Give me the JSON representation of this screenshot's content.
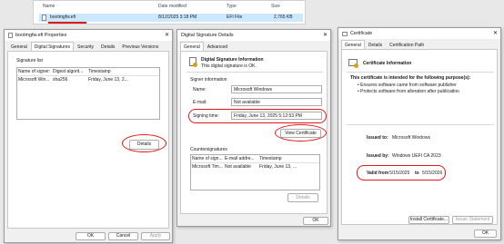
{
  "explorer": {
    "columns": {
      "name": "Name",
      "date": "Date modified",
      "type": "Type",
      "size": "Size"
    },
    "row": {
      "name": "bootmgfw.efi",
      "date": "8/12/2025 3:18 PM",
      "type": "EFI File",
      "size": "2,765 KB"
    }
  },
  "props": {
    "title": "bootmgfw.efi Properties",
    "tabs": [
      "General",
      "Digital Signatures",
      "Security",
      "Details",
      "Previous Versions"
    ],
    "sig_list_label": "Signature list",
    "columns": [
      "Name of signer:",
      "Digest algorit...",
      "Timestamp"
    ],
    "rows": [
      [
        "Microsoft Win...",
        "sha256",
        "Friday, June 13, 2..."
      ]
    ],
    "details_button": "Details",
    "ok": "OK",
    "cancel": "Cancel",
    "apply": "Apply"
  },
  "dsd": {
    "title": "Digital Signature Details",
    "tabs": [
      "General",
      "Advanced"
    ],
    "info_title": "Digital Signature Information",
    "info_sub": "This digital signature is OK.",
    "signer_label": "Signer information",
    "name_label": "Name:",
    "name_value": "Microsoft Windows",
    "email_label": "E-mail:",
    "email_value": "Not available",
    "signing_label": "Signing time:",
    "signing_value": "Friday, June 13, 2025 5:12:53 PM",
    "view_cert": "View Certificate",
    "countersig_label": "Countersignatures",
    "cs_columns": [
      "Name of sign...",
      "E-mail addre...",
      "Timestamp"
    ],
    "cs_rows": [
      [
        "Microsoft Tim...",
        "Not available",
        "Friday, June 13, ..."
      ]
    ],
    "details_button": "Details",
    "ok": "OK"
  },
  "cert": {
    "title": "Certificate",
    "tabs": [
      "General",
      "Details",
      "Certification Path"
    ],
    "info_title": "Certificate Information",
    "intended": "This certificate is intended for the following purpose(s):",
    "purposes": [
      "Ensures software came from software publisher",
      "Protects software from alteration after publication"
    ],
    "issued_to_label": "Issued to:",
    "issued_to_value": "Microsoft Windows",
    "issued_by_label": "Issued by:",
    "issued_by_value": "Windows UEFI CA 2023",
    "valid_from_label": "Valid from",
    "valid_from_value": "5/15/2025",
    "valid_to_label": "to",
    "valid_to_value": "5/15/2026",
    "install_button": "Install Certificate...",
    "issuer_button": "Issuer Statement",
    "ok": "OK"
  },
  "colors": {
    "highlight": "#e01818",
    "selection": "#cce8ff"
  }
}
